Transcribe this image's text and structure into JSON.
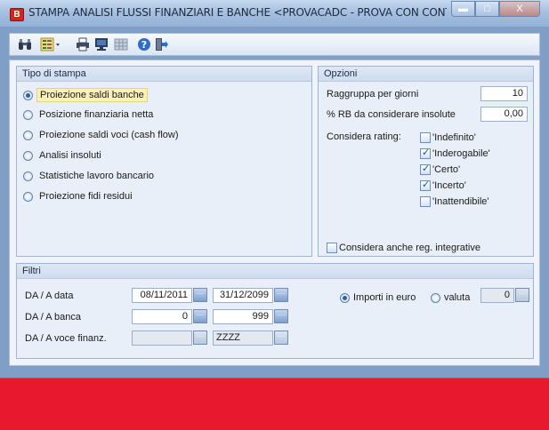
{
  "window": {
    "title": "STAMPA ANALISI FLUSSI FINANZIARI E BANCHE <PROVACADC - PROVA CON CONT...",
    "app_icon_letter": "B",
    "controls": {
      "minimize": "▬",
      "maximize": "□",
      "close": "X"
    }
  },
  "toolbar": {
    "icons": [
      "binoculars-icon",
      "layout-icon",
      "printer-icon",
      "monitor-icon",
      "grid-icon",
      "help-icon",
      "exit-icon"
    ]
  },
  "tipo_di_stampa": {
    "header": "Tipo di stampa",
    "options": [
      {
        "label": "Proiezione saldi banche",
        "selected": true
      },
      {
        "label": "Posizione finanziaria netta",
        "selected": false
      },
      {
        "label": "Proiezione saldi voci (cash flow)",
        "selected": false
      },
      {
        "label": "Analisi insoluti",
        "selected": false
      },
      {
        "label": "Statistiche lavoro bancario",
        "selected": false
      },
      {
        "label": "Proiezione fidi residui",
        "selected": false
      }
    ]
  },
  "opzioni": {
    "header": "Opzioni",
    "raggruppa_label": "Raggruppa per giorni",
    "raggruppa_value": "10",
    "rb_label": "% RB da considerare insolute",
    "rb_value": "0,00",
    "rating_label": "Considera rating:",
    "ratings": [
      {
        "label": "'Indefinito'",
        "checked": false
      },
      {
        "label": "'Inderogabile'",
        "checked": true
      },
      {
        "label": "'Certo'",
        "checked": true
      },
      {
        "label": "'Incerto'",
        "checked": true
      },
      {
        "label": "'Inattendibile'",
        "checked": false
      }
    ],
    "integrative_label": "Considera anche reg. integrative"
  },
  "filtri": {
    "header": "Filtri",
    "data_label": "DA / A data",
    "data_from": "08/11/2011",
    "data_to": "31/12/2099",
    "banca_label": "DA / A banca",
    "banca_from": "0",
    "banca_to": "999",
    "voce_label": "DA / A voce finanz.",
    "voce_from": "",
    "voce_to": "ZZZZ",
    "importi_label": "Importi in euro",
    "valuta_label": "valuta",
    "valuta_value": "0"
  }
}
